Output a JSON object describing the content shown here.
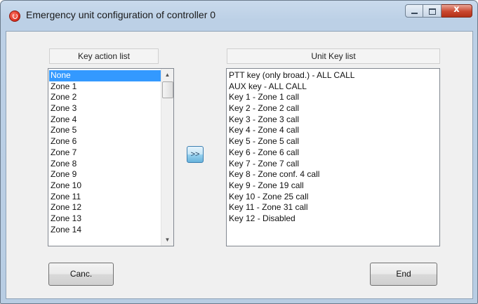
{
  "window": {
    "title": "Emergency unit configuration of controller 0",
    "close_glyph": "x"
  },
  "key_action_list": {
    "header": "Key action list",
    "items": [
      "None",
      "Zone 1",
      "Zone 2",
      "Zone 3",
      "Zone 4",
      "Zone 5",
      "Zone 6",
      "Zone 7",
      "Zone 8",
      "Zone 9",
      "Zone 10",
      "Zone 11",
      "Zone 12",
      "Zone 13",
      "Zone 14"
    ],
    "selected_value": "None"
  },
  "transfer_button": {
    "label": ">>"
  },
  "unit_key_list": {
    "header": "Unit Key list",
    "items": [
      "PTT key (only broad.) - ALL CALL",
      "AUX key - ALL CALL",
      "Key 1 - Zone 1 call",
      "Key 2 - Zone 2 call",
      "Key 3 - Zone 3 call",
      "Key 4 - Zone 4 call",
      "Key 5 - Zone 5 call",
      "Key 6 - Zone 6 call",
      "Key 7 - Zone 7 call",
      "Key 8 - Zone conf. 4 call",
      "Key 9 - Zone 19 call",
      "Key 10 - Zone 25 call",
      "Key 11 - Zone 31 call",
      "Key 12 - Disabled"
    ]
  },
  "buttons": {
    "cancel_label": "Canc.",
    "end_label": "End"
  },
  "icons": {
    "app": "app-icon",
    "minimize": "minimize-icon",
    "maximize": "maximize-icon",
    "close": "close-icon",
    "scroll_up": "scroll-up-arrow-icon",
    "scroll_down": "scroll-down-arrow-icon"
  },
  "colors": {
    "selection": "#3399ff",
    "close_button": "#c9472f",
    "window_frame": "#bcd0e6"
  }
}
